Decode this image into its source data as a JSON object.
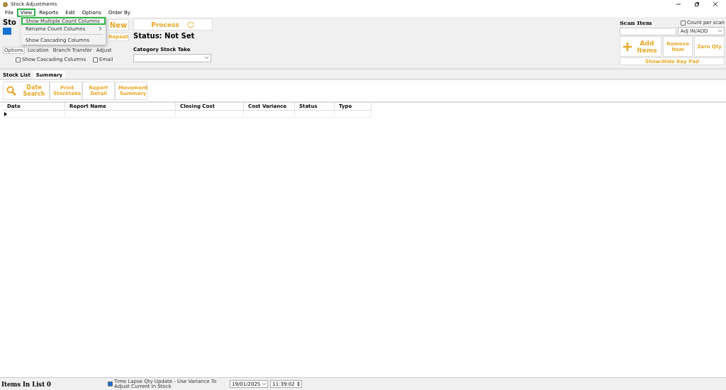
{
  "window": {
    "title": "Stock Adjustments"
  },
  "menu": [
    {
      "label": "File",
      "selected": false
    },
    {
      "label": "View",
      "selected": true
    },
    {
      "label": "Reports",
      "selected": false
    },
    {
      "label": "Edit",
      "selected": false
    },
    {
      "label": "Options",
      "selected": false
    },
    {
      "label": "Order By",
      "selected": false
    }
  ],
  "view_menu": [
    {
      "label": "Show Multiple Count Columns",
      "selected": true,
      "submenu": false
    },
    {
      "label": "Rename Count Columns",
      "selected": false,
      "submenu": true
    },
    {
      "label": "Show Cascading Columns",
      "selected": false,
      "submenu": false
    }
  ],
  "left_panel": {
    "heading": "Sto",
    "tabs": [
      {
        "label": "Options",
        "selected": true
      },
      {
        "label": "Location",
        "selected": false
      },
      {
        "label": "Branch Transfer",
        "selected": false
      },
      {
        "label": "Adjust",
        "selected": false
      }
    ],
    "checkboxes": [
      {
        "label": "Show Cascading Columns",
        "checked": false
      },
      {
        "label": "Email",
        "checked": false
      }
    ]
  },
  "new_button": "New",
  "repeat_button": "Repeat",
  "process_button": "Process",
  "status": "Status: Not Set",
  "category": {
    "label": "Category Stock Take"
  },
  "scan": {
    "title": "Scan Item",
    "count_per_scan": {
      "label": "Count per scan",
      "checked": false
    },
    "mode": "Adj IN/ADD",
    "buttons": [
      {
        "kind": "add",
        "label": "Add Items"
      },
      {
        "kind": "plain",
        "label": "Remove Item"
      },
      {
        "kind": "plain",
        "label": "Zero Qty"
      }
    ],
    "keypad": "Show\\Hide Key Pad"
  },
  "tabs": [
    {
      "label": "Stock List",
      "selected": false
    },
    {
      "label": "Summary",
      "selected": true
    }
  ],
  "toolbar": [
    {
      "kind": "search",
      "label": "Date Search"
    },
    {
      "kind": "plain",
      "label": "Print Stocktake"
    },
    {
      "kind": "plain",
      "label": "Report Detail"
    },
    {
      "kind": "plain",
      "label": "Movement Summary"
    }
  ],
  "table": {
    "columns": [
      "Date",
      "Report Name",
      "Closing Cost",
      "Cost Variance",
      "Status",
      "Type"
    ]
  },
  "status_bar": {
    "items": "Items In List 0",
    "time_lapse": {
      "label": "Time Lapse Qty Update - Use Variance To Adjust Current In Stock",
      "checked": true
    },
    "date": "19/01/2025",
    "time": "11:39:02"
  }
}
